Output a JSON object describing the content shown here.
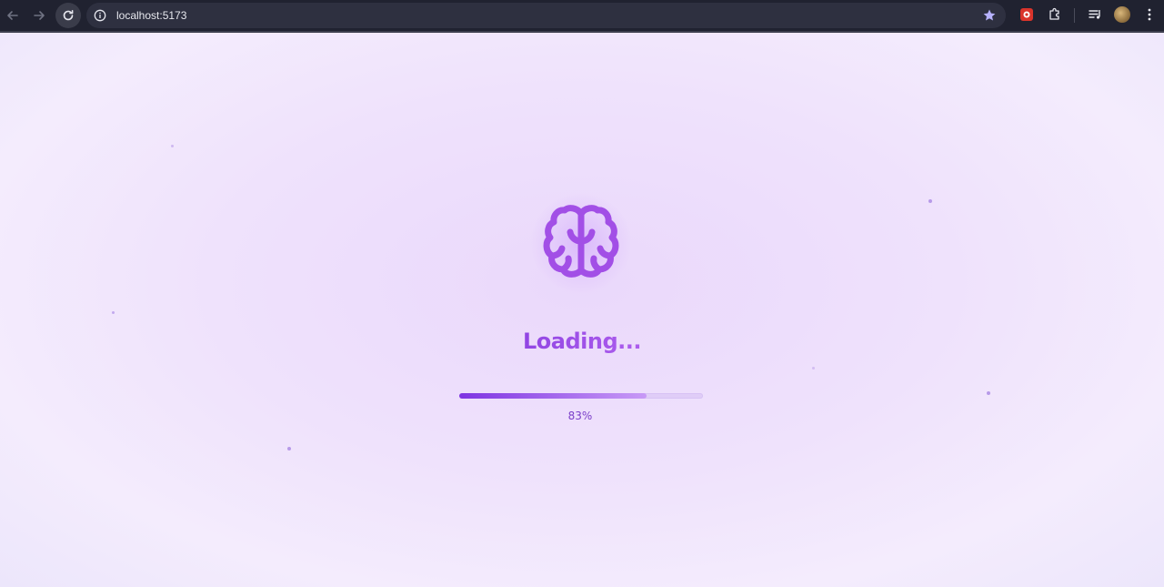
{
  "browser": {
    "url": "localhost:5173",
    "icons": {
      "back": "arrow-left-icon",
      "forward": "arrow-right-icon",
      "reload": "reload-icon",
      "info": "info-icon",
      "bookmark": "star-icon",
      "extension_red": "extension-icon",
      "extensions": "puzzle-icon",
      "media": "media-controls-icon",
      "profile": "avatar",
      "menu": "kebab-menu-icon"
    },
    "bookmark_color": "#b7b2ff"
  },
  "loader": {
    "icon": "brain-icon",
    "icon_color": "#a04fe6",
    "title": "Loading...",
    "progress": 0.77,
    "percent_label": "83%",
    "accent": "#7e34e2"
  }
}
